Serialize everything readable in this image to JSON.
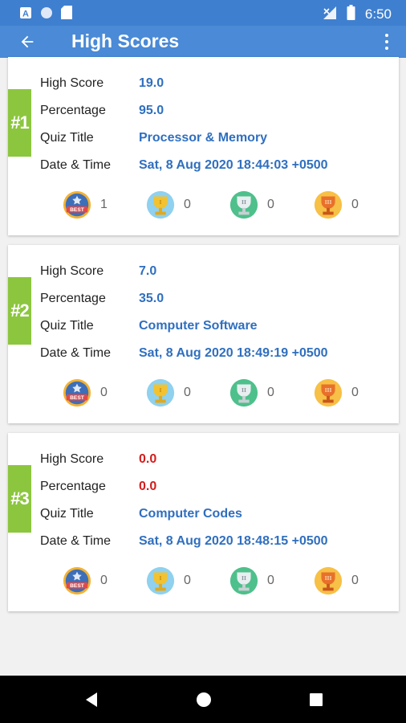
{
  "status_bar": {
    "time": "6:50"
  },
  "app_bar": {
    "title": "High Scores"
  },
  "labels": {
    "high_score": "High Score",
    "percentage": "Percentage",
    "quiz_title": "Quiz Title",
    "date_time": "Date & Time"
  },
  "colors": {
    "primary": "#4a8ad6",
    "status": "#3f7fcf",
    "rank_tab": "#8cc63f",
    "value": "#2f6fbf",
    "zero_value": "#d31c1c"
  },
  "scores": [
    {
      "rank": "#1",
      "high_score": "19.0",
      "percentage": "95.0",
      "quiz_title": "Processor & Memory",
      "date_time": "Sat, 8 Aug 2020 18:44:03 +0500",
      "awards": {
        "best": "1",
        "gold": "0",
        "silver": "0",
        "bronze": "0"
      }
    },
    {
      "rank": "#2",
      "high_score": "7.0",
      "percentage": "35.0",
      "quiz_title": "Computer Software",
      "date_time": "Sat, 8 Aug 2020 18:49:19 +0500",
      "awards": {
        "best": "0",
        "gold": "0",
        "silver": "0",
        "bronze": "0"
      }
    },
    {
      "rank": "#3",
      "high_score": "0.0",
      "percentage": "0.0",
      "quiz_title": "Computer Codes",
      "date_time": "Sat, 8 Aug 2020 18:48:15 +0500",
      "awards": {
        "best": "0",
        "gold": "0",
        "silver": "0",
        "bronze": "0"
      }
    }
  ],
  "icons": [
    "arrow-back-icon",
    "more-vert-icon",
    "best-badge-icon",
    "gold-trophy-icon",
    "silver-trophy-icon",
    "bronze-trophy-icon",
    "nav-back-icon",
    "nav-home-icon",
    "nav-recents-icon"
  ]
}
